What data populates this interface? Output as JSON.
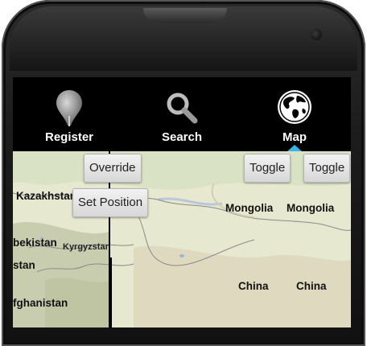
{
  "tabs": [
    {
      "label": "Register",
      "icon": "map-pin-icon"
    },
    {
      "label": "Search",
      "icon": "magnifier-icon"
    },
    {
      "label": "Map",
      "icon": "globe-icon",
      "active": true
    }
  ],
  "accent_color": "#33b5e5",
  "buttons": {
    "override": "Override",
    "set_position": "Set Position",
    "toggle_1": "Toggle",
    "toggle_2": "Toggle"
  },
  "map_labels": {
    "kazakhstan": "Kazakhstan",
    "mongolia_1": "Mongolia",
    "mongolia_2": "Mongolia",
    "uzbekistan": "bekistan",
    "kyrgyzstan": "Kyrgyzstan",
    "tajikistan": "stan",
    "afghanistan": "fghanistan",
    "china_1": "China",
    "china_2": "China"
  }
}
